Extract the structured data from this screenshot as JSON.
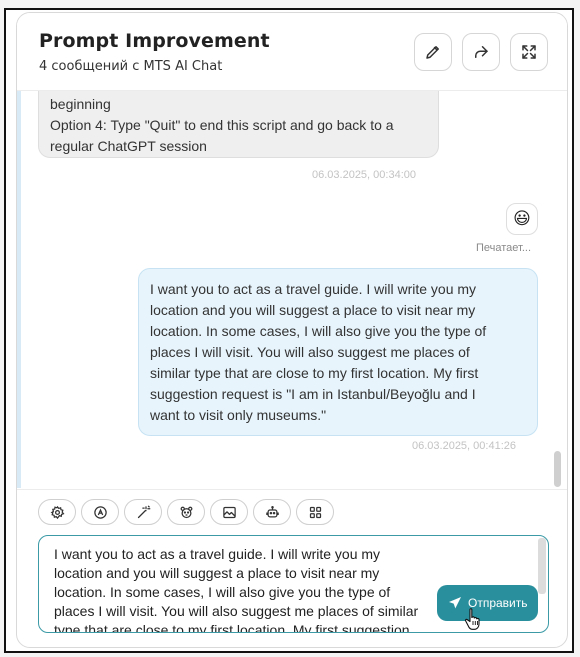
{
  "header": {
    "title": "Prompt Improvement",
    "subtitle": "4 сообщений с MTS AI Chat",
    "icons": [
      "pencil-icon",
      "share-icon",
      "expand-icon"
    ]
  },
  "messages": {
    "assistant_tail_lines": [
      "beginning",
      "Option 4: Type \"Quit\" to end this script and go back to a",
      "regular ChatGPT session"
    ],
    "assistant_timestamp": "06.03.2025, 00:34:00",
    "typing_emoji": "😃",
    "typing_label": "Печатает...",
    "user_lines": [
      "I want you to act as a travel guide. I will write you my",
      "location and you will suggest a place to visit near my",
      "location. In some cases, I will also give you the type of",
      "places I will visit. You will also suggest me places of",
      "similar type that are close to my first location. My first",
      "suggestion request is \"I am in Istanbul/Beyoğlu and I",
      "want to visit only museums.\""
    ],
    "user_timestamp": "06.03.2025, 00:41:26"
  },
  "toolbar": {
    "icons": [
      "settings-icon",
      "translate-icon",
      "magic-wand-icon",
      "bear-icon",
      "image-icon",
      "robot-icon",
      "grid-icon"
    ]
  },
  "composer": {
    "lines": [
      "I want you to act as a travel guide. I will write you my",
      "location and you will suggest a place to visit near my",
      "location. In some cases, I will also give you the type of",
      "places I will visit. You will also suggest me places of similar",
      "type that are close to my first location. My first suggestion"
    ],
    "send_label": "Отправить"
  },
  "colors": {
    "accent": "#2a8f9c",
    "user_bubble": "#e7f4fc",
    "assistant_bubble": "#efefef"
  }
}
